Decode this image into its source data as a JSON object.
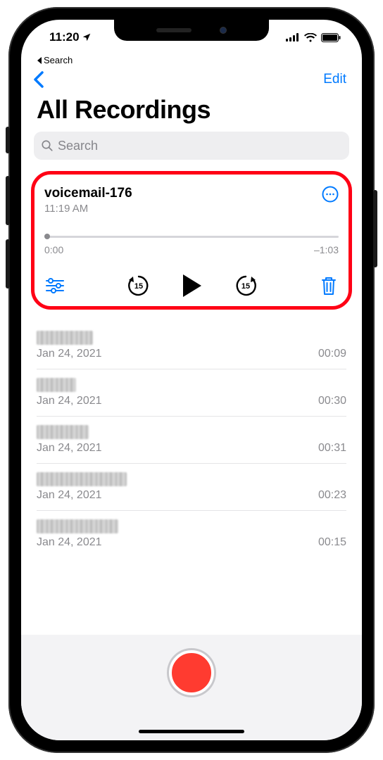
{
  "status": {
    "time": "11:20",
    "back_app": "Search"
  },
  "nav": {
    "edit": "Edit"
  },
  "title": "All Recordings",
  "search": {
    "placeholder": "Search"
  },
  "selected": {
    "title": "voicemail-176",
    "subtitle": "11:19 AM",
    "elapsed": "0:00",
    "remaining": "–1:03"
  },
  "rows": [
    {
      "title_width": 80,
      "date": "Jan 24, 2021",
      "duration": "00:09"
    },
    {
      "title_width": 56,
      "date": "Jan 24, 2021",
      "duration": "00:30"
    },
    {
      "title_width": 74,
      "date": "Jan 24, 2021",
      "duration": "00:31"
    },
    {
      "title_width": 128,
      "date": "Jan 24, 2021",
      "duration": "00:23"
    },
    {
      "title_width": 116,
      "date": "Jan 24, 2021",
      "duration": "00:15"
    }
  ]
}
